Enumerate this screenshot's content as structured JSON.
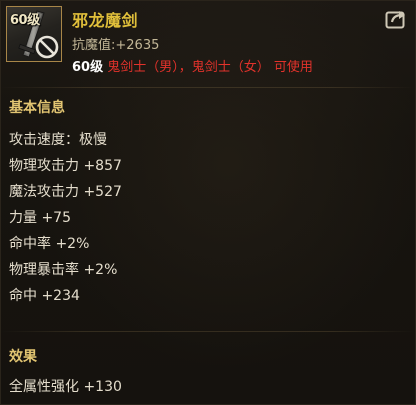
{
  "item": {
    "level_badge": "60级",
    "name": "邪龙魔剑",
    "resist_label": "抗魔值:",
    "resist_value": "+2635",
    "required_level": "60级",
    "required_classes": "鬼剑士（男），鬼剑士（女） 可使用"
  },
  "sections": {
    "basic_info_title": "基本信息",
    "effect_title": "效果"
  },
  "stats": [
    "攻击速度：极慢",
    "物理攻击力 +857",
    "魔法攻击力 +527",
    "力量 +75",
    "命中率 +2%",
    "物理暴击率 +2%",
    "命中 +234"
  ],
  "effects": [
    "全属性强化 +130"
  ],
  "icons": {
    "share": "share-icon",
    "item": "sword-icon",
    "unusable": "no-entry-icon"
  },
  "colors": {
    "item_name": "#e0bf3a",
    "section_title": "#e2c572",
    "requirement_red": "#e2322b",
    "stat_text": "#e4ddcc"
  }
}
